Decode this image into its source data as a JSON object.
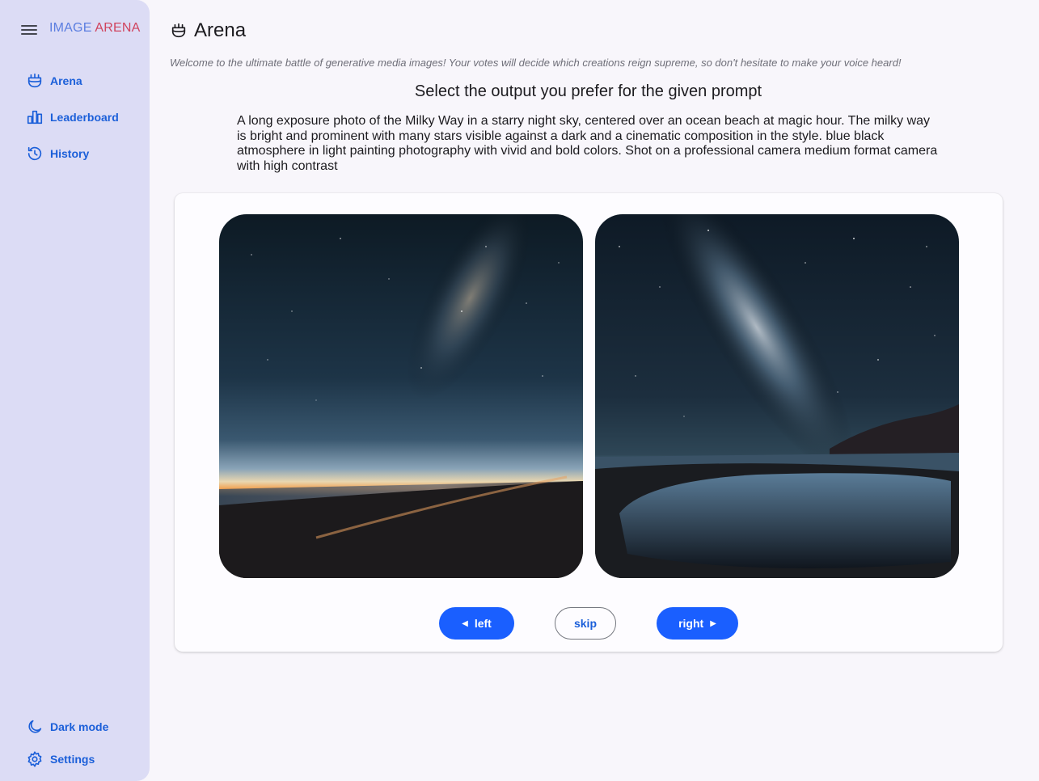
{
  "app": {
    "brand_part1": "IMAGE ",
    "brand_part2": "ARENA"
  },
  "sidebar": {
    "items": [
      {
        "label": "Arena",
        "icon": "arena-icon"
      },
      {
        "label": "Leaderboard",
        "icon": "leaderboard-icon"
      },
      {
        "label": "History",
        "icon": "history-icon"
      }
    ],
    "bottom": [
      {
        "label": "Dark mode",
        "icon": "moon-icon"
      },
      {
        "label": "Settings",
        "icon": "gear-icon"
      }
    ]
  },
  "main": {
    "title": "Arena",
    "welcome": "Welcome to the ultimate battle of generative media images! Your votes will decide which creations reign supreme, so don't hesitate to make your voice heard!",
    "heading": "Select the output you prefer for the given prompt",
    "prompt": "A long exposure photo of the Milky Way in a starry night sky, centered over an ocean beach at magic hour. The milky way is bright and prominent with many stars visible against a dark and a cinematic composition in the style. blue black atmosphere in light painting photography with vivid and bold colors. Shot on a professional camera medium format camera with high contrast"
  },
  "buttons": {
    "left": "left",
    "skip": "skip",
    "right": "right"
  },
  "colors": {
    "accent": "#1a5fff",
    "sidebar_bg": "#dcdcf5",
    "brand_blue": "#5b7ee0",
    "brand_red": "#d0445e"
  }
}
